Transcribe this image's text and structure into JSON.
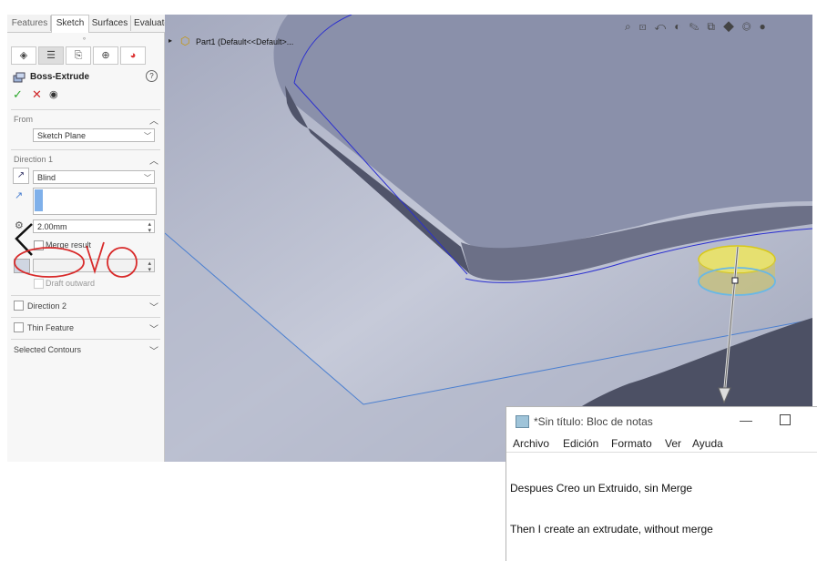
{
  "tabs": [
    "Features",
    "Sketch",
    "Surfaces",
    "Evaluate"
  ],
  "property_manager": {
    "title": "Boss-Extrude",
    "from": {
      "label": "From",
      "value": "Sketch Plane"
    },
    "direction1": {
      "label": "Direction 1",
      "end_condition": "Blind",
      "depth": "2.00mm",
      "merge_label": "Merge result",
      "draft_label": "Draft outward"
    },
    "direction2_label": "Direction 2",
    "thin_label": "Thin Feature",
    "contours_label": "Selected Contours",
    "colors": {
      "ok": "#2da82d",
      "cancel": "#d0282a",
      "accent": "#4a7fd0"
    }
  },
  "tree": {
    "part_label": "Part1  (Default<<Default>..."
  },
  "notepad": {
    "title": "*Sin título: Bloc de notas",
    "menu": [
      "Archivo",
      "Edición",
      "Formato",
      "Ver",
      "Ayuda"
    ],
    "lines": [
      "Despues Creo un Extruido, sin Merge",
      "Then I create an extrudate, without merge"
    ]
  },
  "annotation": {
    "handwritten": "OK",
    "color": "#d82a2a"
  }
}
